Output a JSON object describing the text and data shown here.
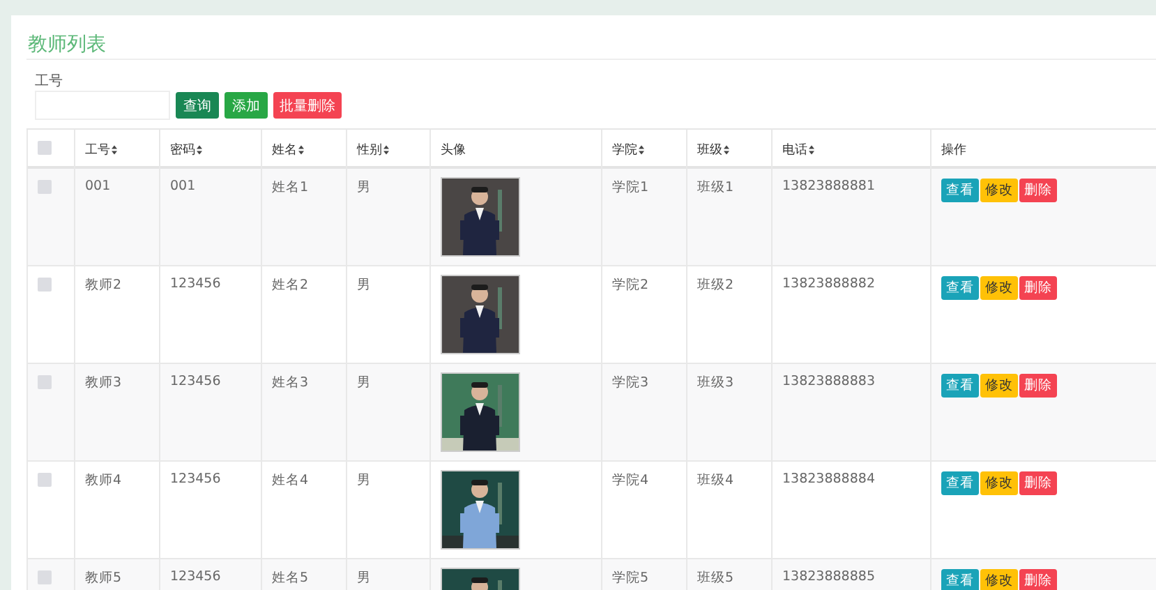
{
  "title": "教师列表",
  "search": {
    "label": "工号"
  },
  "toolbar": [
    {
      "label": "查询",
      "kind": "search"
    },
    {
      "label": "添加",
      "kind": "add"
    },
    {
      "label": "批量删除",
      "kind": "delete"
    }
  ],
  "table": {
    "select_all": {
      "checked": false
    },
    "columns": [
      {
        "label": "工号",
        "sortable": true
      },
      {
        "label": "密码",
        "sortable": true
      },
      {
        "label": "姓名",
        "sortable": true
      },
      {
        "label": "性别",
        "sortable": true
      },
      {
        "label": "头像",
        "sortable": false
      },
      {
        "label": "学院",
        "sortable": true
      },
      {
        "label": "班级",
        "sortable": true
      },
      {
        "label": "电话",
        "sortable": true
      },
      {
        "label": "操作",
        "sortable": false
      }
    ],
    "rows": [
      {
        "checked": false,
        "id": "001",
        "password": "001",
        "name": "姓名1",
        "gender": "男",
        "college": "学院1",
        "class": "班级1",
        "phone": "13823888881",
        "actions": [
          {
            "label": "查看",
            "kind": "view"
          },
          {
            "label": "修改",
            "kind": "edit"
          },
          {
            "label": "删除",
            "kind": "delete"
          }
        ]
      },
      {
        "checked": false,
        "id": "教师2",
        "password": "123456",
        "name": "姓名2",
        "gender": "男",
        "college": "学院2",
        "class": "班级2",
        "phone": "13823888882",
        "actions": [
          {
            "label": "查看",
            "kind": "view"
          },
          {
            "label": "修改",
            "kind": "edit"
          },
          {
            "label": "删除",
            "kind": "delete"
          }
        ]
      },
      {
        "checked": false,
        "id": "教师3",
        "password": "123456",
        "name": "姓名3",
        "gender": "男",
        "college": "学院3",
        "class": "班级3",
        "phone": "13823888883",
        "actions": [
          {
            "label": "查看",
            "kind": "view"
          },
          {
            "label": "修改",
            "kind": "edit"
          },
          {
            "label": "删除",
            "kind": "delete"
          }
        ]
      },
      {
        "checked": false,
        "id": "教师4",
        "password": "123456",
        "name": "姓名4",
        "gender": "男",
        "college": "学院4",
        "class": "班级4",
        "phone": "13823888884",
        "actions": [
          {
            "label": "查看",
            "kind": "view"
          },
          {
            "label": "修改",
            "kind": "edit"
          },
          {
            "label": "删除",
            "kind": "delete"
          }
        ]
      },
      {
        "checked": false,
        "id": "教师5",
        "password": "123456",
        "name": "姓名5",
        "gender": "男",
        "college": "学院5",
        "class": "班级5",
        "phone": "13823888885",
        "actions": [
          {
            "label": "查看",
            "kind": "view"
          },
          {
            "label": "修改",
            "kind": "edit"
          },
          {
            "label": "删除",
            "kind": "delete"
          }
        ]
      }
    ]
  }
}
